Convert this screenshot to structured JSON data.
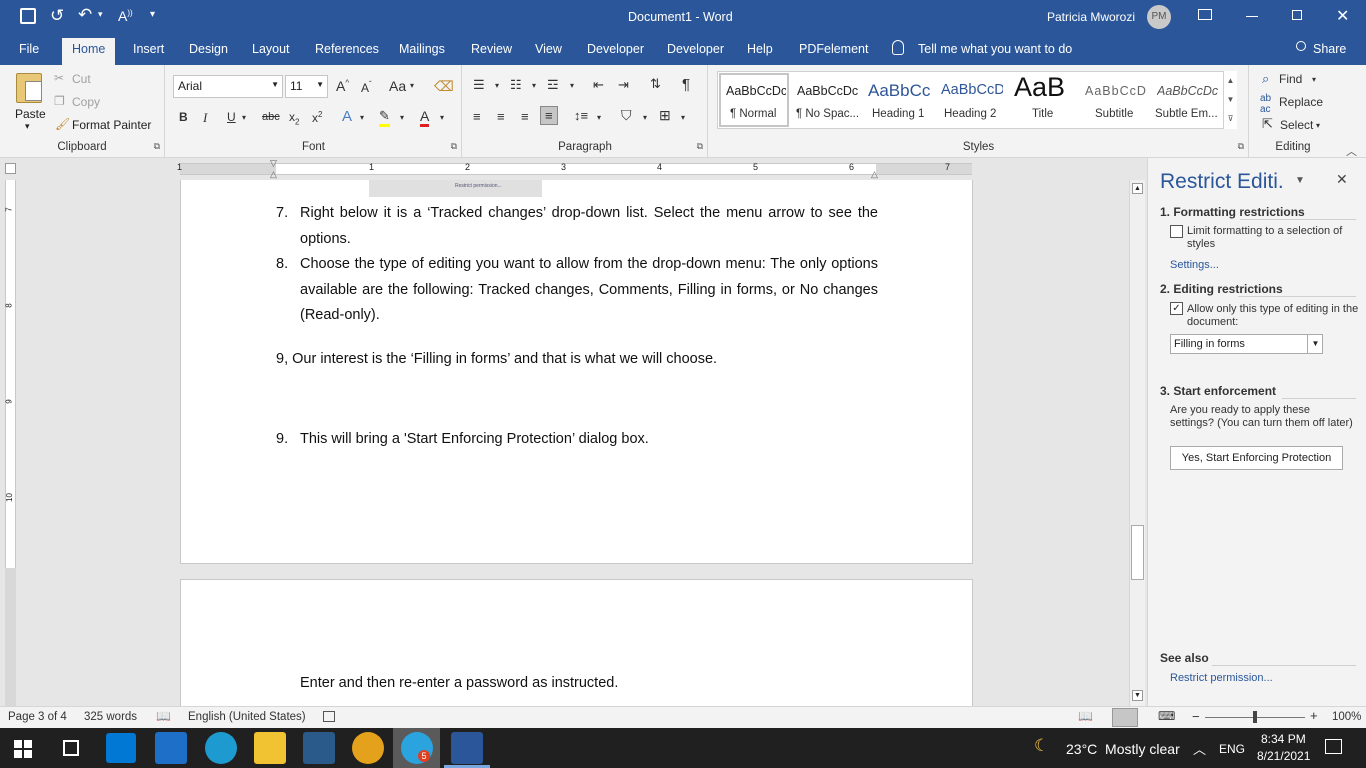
{
  "window": {
    "title": "Document1 - Word",
    "user_name": "Patricia Mworozi",
    "user_initials": "PM"
  },
  "tabs": [
    "File",
    "Home",
    "Insert",
    "Design",
    "Layout",
    "References",
    "Mailings",
    "Review",
    "View",
    "Developer",
    "Developer",
    "Help",
    "PDFelement"
  ],
  "tell_me": "Tell me what you want to do",
  "share_label": "Share",
  "clipboard": {
    "paste": "Paste",
    "cut": "Cut",
    "copy": "Copy",
    "format_painter": "Format Painter",
    "group": "Clipboard"
  },
  "font": {
    "name": "Arial",
    "size": "11",
    "group": "Font",
    "case_label": "Aa"
  },
  "paragraph": {
    "group": "Paragraph"
  },
  "styles": {
    "group": "Styles",
    "items": [
      {
        "preview": "AaBbCcDc",
        "label": "¶ Normal"
      },
      {
        "preview": "AaBbCcDc",
        "label": "¶ No Spac..."
      },
      {
        "preview": "AaBbCc",
        "label": "Heading 1"
      },
      {
        "preview": "AaBbCcD",
        "label": "Heading 2"
      },
      {
        "preview": "AaB",
        "label": "Title"
      },
      {
        "preview": "AaBbCcD",
        "label": "Subtitle"
      },
      {
        "preview": "AaBbCcDc",
        "label": "Subtle Em..."
      }
    ]
  },
  "editing": {
    "find": "Find",
    "replace": "Replace",
    "select": "Select",
    "group": "Editing"
  },
  "ruler": {
    "numbers": [
      "1",
      "1",
      "2",
      "3",
      "4",
      "5",
      "6",
      "7"
    ],
    "vnumbers": [
      "7",
      "8",
      "9",
      "10"
    ]
  },
  "document": {
    "page_thumb": "Restrict permission...",
    "items": [
      {
        "num": "7.",
        "lines": [
          "Right below it is a ‘Tracked changes’ drop-down list. Select the menu arrow to see the",
          "options."
        ]
      },
      {
        "num": "8.",
        "lines": [
          "Choose the type of editing you want to allow from the drop-down menu: The only options",
          "available are the following: Tracked changes, Comments, Filling in forms, or No changes",
          "(Read-only)."
        ]
      }
    ],
    "plain_line": "9, Our interest is the ‘Filling in forms’ and that is what we will choose.",
    "item9": {
      "num": "9.",
      "text": "This will bring a 'Start Enforcing Protection’ dialog box."
    },
    "page2_line": "Enter and then re-enter a password as instructed."
  },
  "pane": {
    "title": "Restrict Editi..",
    "section1": "1. Formatting restrictions",
    "limit_formatting": "Limit formatting to a selection of styles",
    "settings_link": "Settings...",
    "section2": "2. Editing restrictions",
    "allow_only": "Allow only this type of editing in the document:",
    "dropdown_value": "Filling in forms",
    "section3": "3. Start enforcement",
    "ready_text": "Are you ready to apply these settings? (You can turn them off later)",
    "enforce_button": "Yes, Start Enforcing Protection",
    "see_also": "See also",
    "restrict_link": "Restrict permission..."
  },
  "status": {
    "page": "Page 3 of 4",
    "words": "325 words",
    "language": "English (United States)",
    "zoom": "100%"
  },
  "taskbar": {
    "weather": "23°C  Mostly clear",
    "lang": "ENG",
    "time": "8:34 PM",
    "date": "8/21/2021",
    "badge": "5"
  },
  "colors": {
    "accent": "#2b579a",
    "link": "#2b579a"
  }
}
